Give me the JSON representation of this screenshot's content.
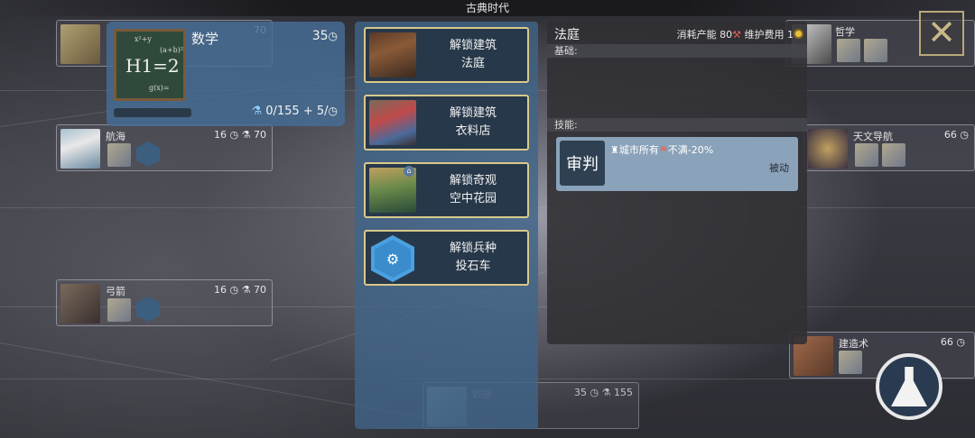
{
  "era": {
    "title": "古典时代"
  },
  "tech": {
    "name": "数学",
    "cost": "35",
    "progress": "0/155 + 5/",
    "chalk_eq": "H1=2",
    "chalk_a": "(a+b)²",
    "chalk_b": "x²+y",
    "chalk_c": "g(x)="
  },
  "unlocks": [
    {
      "line1": "解锁建筑",
      "line2": "法庭",
      "pic": "gavel"
    },
    {
      "line1": "解锁建筑",
      "line2": "衣料店",
      "pic": "cloth"
    },
    {
      "line1": "解锁奇观",
      "line2": "空中花园",
      "pic": "garden"
    },
    {
      "line1": "解锁兵种",
      "line2": "投石车",
      "pic": "catapult"
    }
  ],
  "detail": {
    "name": "法庭",
    "production_label": "消耗产能",
    "production_value": "80",
    "upkeep_label": "维护费用",
    "upkeep_value": "1",
    "basic_label": "基础:",
    "skill_label": "技能:",
    "skill": {
      "icon_text": "审判",
      "desc": "城市所有",
      "effect": "不满-20%",
      "type": "被动"
    }
  },
  "bg_nodes": [
    {
      "name": "",
      "cost": "70"
    },
    {
      "name": "航海",
      "cost": "16",
      "beaker": "70"
    },
    {
      "name": "弓箭",
      "cost": "16",
      "beaker": "70"
    },
    {
      "name": "哲学",
      "cost": ""
    },
    {
      "name": "天文导航",
      "cost": "66"
    },
    {
      "name": "建造术",
      "cost": "66"
    },
    {
      "name": "数据",
      "cost": "35",
      "beaker": "155"
    }
  ],
  "ghost_costs": [
    "35",
    "155",
    "35",
    "155"
  ],
  "colors": {
    "panel_blue": "#4a6a8a",
    "gold_border": "#d9c98a",
    "accent_hex": "#4aa0e0"
  }
}
